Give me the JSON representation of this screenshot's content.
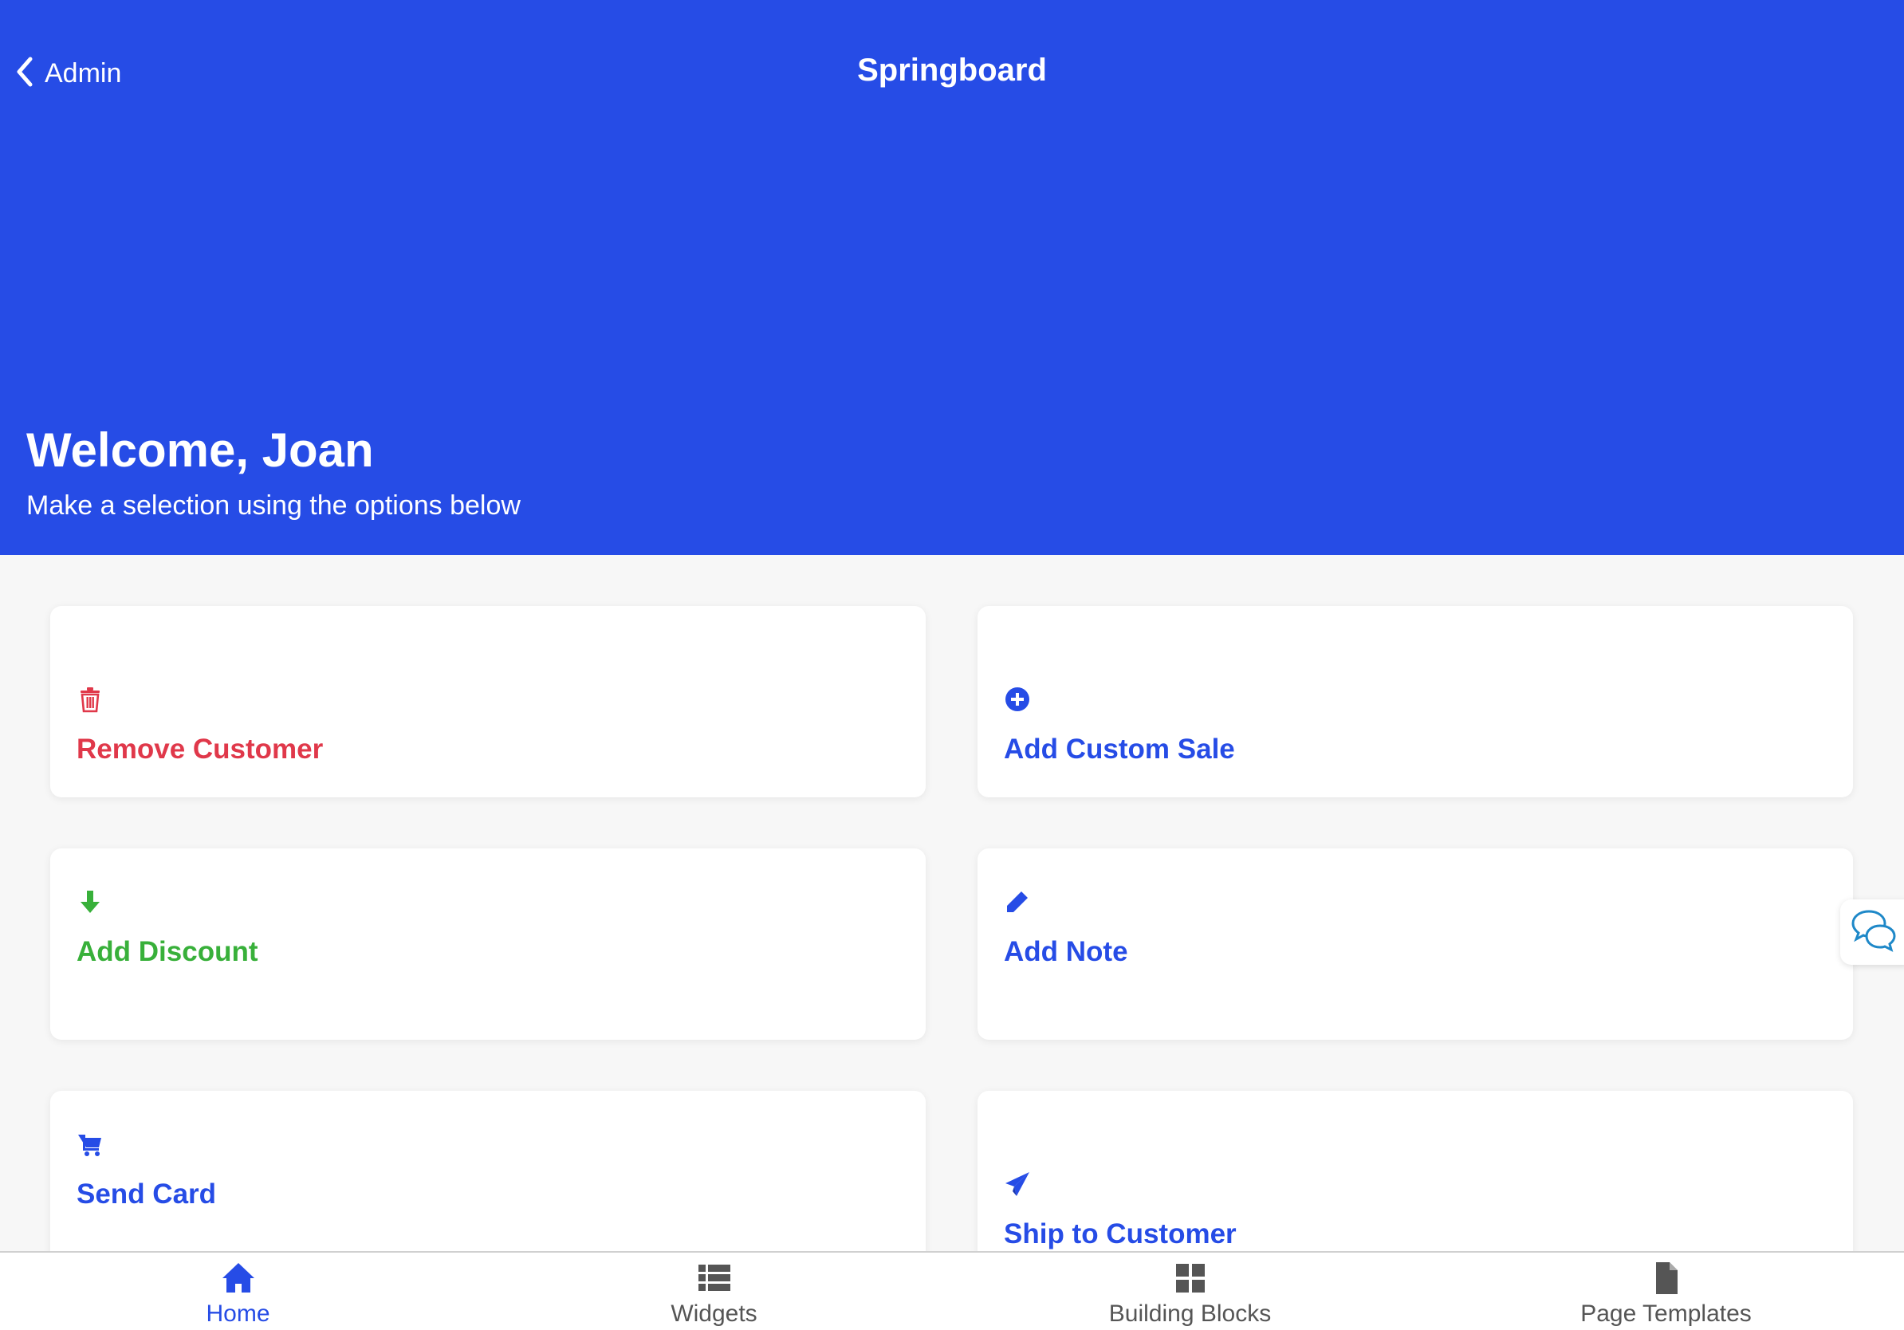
{
  "colors": {
    "brand": "#264ce6",
    "danger": "#e0384a",
    "success": "#38b03a",
    "tab_inactive": "#555555"
  },
  "nav": {
    "back_label": "Admin",
    "title": "Springboard"
  },
  "hero": {
    "welcome": "Welcome, Joan",
    "subtitle": "Make a selection using the options below"
  },
  "cards": [
    {
      "label": "Remove Customer",
      "icon": "trash-icon",
      "color": "danger"
    },
    {
      "label": "Add Custom Sale",
      "icon": "plus-circle-icon",
      "color": "brand"
    },
    {
      "label": "Add Discount",
      "icon": "arrow-down-icon",
      "color": "success"
    },
    {
      "label": "Add Note",
      "icon": "pencil-icon",
      "color": "brand"
    },
    {
      "label": "Send Card",
      "icon": "cart-icon",
      "color": "brand"
    },
    {
      "label": "Ship to Customer",
      "icon": "paper-plane-icon",
      "color": "brand"
    }
  ],
  "chat": {
    "icon": "chat-bubbles-icon"
  },
  "tabs": [
    {
      "label": "Home",
      "icon": "home-icon",
      "active": true
    },
    {
      "label": "Widgets",
      "icon": "list-icon",
      "active": false
    },
    {
      "label": "Building Blocks",
      "icon": "grid-icon",
      "active": false
    },
    {
      "label": "Page Templates",
      "icon": "document-icon",
      "active": false
    }
  ]
}
